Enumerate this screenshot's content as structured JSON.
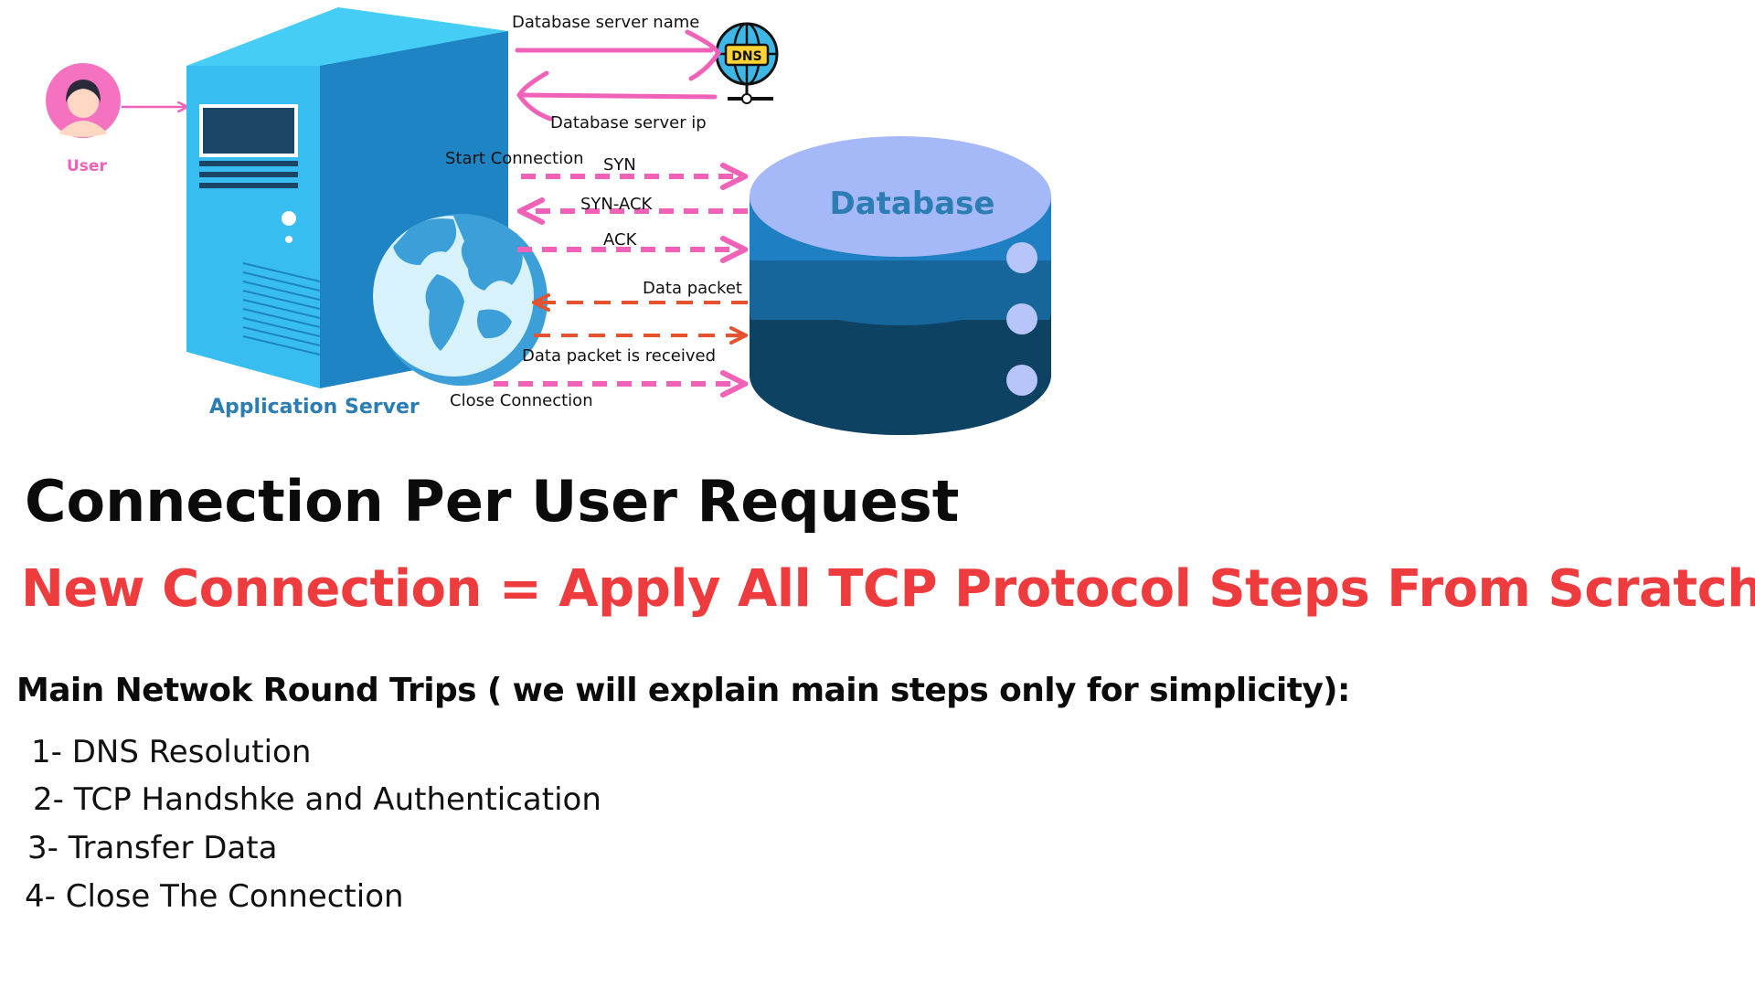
{
  "diagram": {
    "user_label": "User",
    "app_server_label": "Application Server",
    "dns_badge": "DNS",
    "database_label": "Database",
    "arrows": {
      "db_server_name": "Database server name",
      "db_server_ip": "Database server ip",
      "start_connection": "Start Connection",
      "syn": "SYN",
      "syn_ack": "SYN-ACK",
      "ack": "ACK",
      "data_packet": "Data packet",
      "data_packet_received": "Data packet is received",
      "close_connection": "Close Connection"
    },
    "colors": {
      "pink": "#f062b8",
      "orange": "#e8512d",
      "server_light": "#39bff0",
      "server_dark": "#1e80bf",
      "db_top": "#a5b8f8",
      "db_mid": "#1f7bbf",
      "db_dark": "#0e3f5c",
      "label_blue": "#2b7db3"
    }
  },
  "title": "Connection Per User Request",
  "subtitle": "New Connection = Apply All TCP Protocol Steps From Scratch",
  "section_heading": "Main Netwok Round Trips ( we will explain main steps only for simplicity):",
  "steps": [
    "1- DNS Resolution",
    "2- TCP Handshke and Authentication",
    "3- Transfer Data",
    "4- Close The Connection"
  ]
}
